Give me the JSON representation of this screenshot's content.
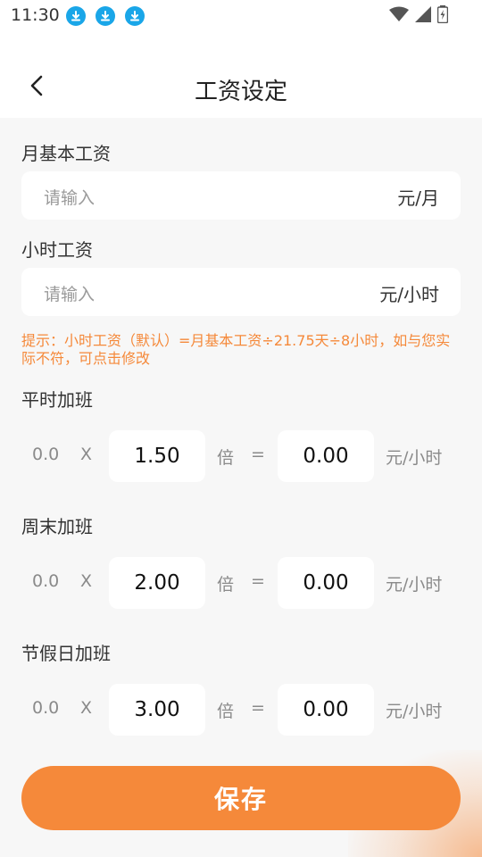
{
  "status_bar": {
    "time": "11:30",
    "icons": [
      "download-icon",
      "download-icon",
      "download-icon",
      "wifi-icon",
      "signal-icon",
      "battery-icon"
    ]
  },
  "header": {
    "title": "工资设定"
  },
  "monthly_salary": {
    "label": "月基本工资",
    "placeholder": "请输入",
    "unit": "元/月"
  },
  "hourly_salary": {
    "label": "小时工资",
    "placeholder": "请输入",
    "unit": "元/小时"
  },
  "hint": "提示：小时工资（默认）=月基本工资÷21.75天÷8小时，如与您实际不符，可点击修改",
  "overtime": [
    {
      "label": "平时加班",
      "base": "0.0",
      "times": "X",
      "multiplier": "1.50",
      "bei": "倍",
      "equals": "=",
      "result": "0.00",
      "unit": "元/小时"
    },
    {
      "label": "周末加班",
      "base": "0.0",
      "times": "X",
      "multiplier": "2.00",
      "bei": "倍",
      "equals": "=",
      "result": "0.00",
      "unit": "元/小时"
    },
    {
      "label": "节假日加班",
      "base": "0.0",
      "times": "X",
      "multiplier": "3.00",
      "bei": "倍",
      "equals": "=",
      "result": "0.00",
      "unit": "元/小时"
    }
  ],
  "save_label": "保存",
  "colors": {
    "accent": "#f5893a",
    "download_icon": "#1aa6e8"
  }
}
